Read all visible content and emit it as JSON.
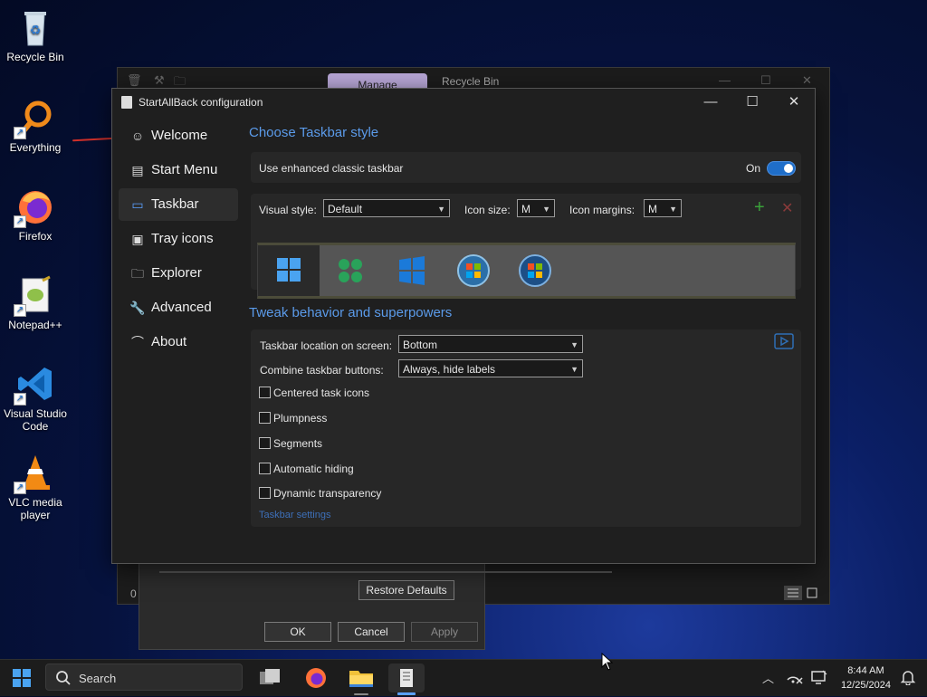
{
  "desktop": {
    "icons": [
      {
        "label": "Recycle Bin",
        "icon": "recycle-bin-icon"
      },
      {
        "label": "Everything",
        "icon": "everything-search-icon"
      },
      {
        "label": "Firefox",
        "icon": "firefox-icon"
      },
      {
        "label": "Notepad++",
        "icon": "notepad-plus-plus-icon"
      },
      {
        "label": "Visual Studio Code",
        "icon": "vscode-icon"
      },
      {
        "label": "VLC media player",
        "icon": "vlc-icon"
      }
    ]
  },
  "background_window": {
    "manage_tab": "Manage",
    "title": "Recycle Bin",
    "status_count": "0"
  },
  "properties_dialog": {
    "restore_defaults": "Restore Defaults",
    "ok": "OK",
    "cancel": "Cancel",
    "apply": "Apply"
  },
  "window": {
    "title": "StartAllBack configuration",
    "controls": {
      "minimize": "—",
      "maximize": "☐",
      "close": "✕"
    }
  },
  "nav": {
    "items": [
      {
        "label": "Welcome",
        "icon": "smiley-icon",
        "active": false
      },
      {
        "label": "Start Menu",
        "icon": "start-menu-icon",
        "active": false
      },
      {
        "label": "Taskbar",
        "icon": "taskbar-icon",
        "active": true
      },
      {
        "label": "Tray icons",
        "icon": "tray-icon",
        "active": false
      },
      {
        "label": "Explorer",
        "icon": "folder-icon",
        "active": false
      },
      {
        "label": "Advanced",
        "icon": "wrench-icon",
        "active": false
      },
      {
        "label": "About",
        "icon": "about-icon",
        "active": false
      }
    ]
  },
  "taskbar_style": {
    "heading": "Choose Taskbar style",
    "enhanced_label": "Use enhanced classic taskbar",
    "enhanced_state": "On",
    "visual_style_label": "Visual style:",
    "visual_style_value": "Default",
    "icon_size_label": "Icon size:",
    "icon_size_value": "M",
    "icon_margins_label": "Icon margins:",
    "icon_margins_value": "M",
    "add_icon": "+",
    "remove_icon": "✕",
    "accent_add": "#3aa13a",
    "accent_remove": "#8a3a3a"
  },
  "tweak": {
    "heading": "Tweak behavior and superpowers",
    "location_label": "Taskbar location on screen:",
    "location_value": "Bottom",
    "combine_label": "Combine taskbar buttons:",
    "combine_value": "Always, hide labels",
    "checkboxes": [
      {
        "label": "Centered task icons",
        "checked": false
      },
      {
        "label": "Plumpness",
        "checked": false
      },
      {
        "label": "Segments",
        "checked": false
      },
      {
        "label": "Automatic hiding",
        "checked": false
      },
      {
        "label": "Dynamic transparency",
        "checked": false
      }
    ],
    "settings_link": "Taskbar settings"
  },
  "taskbar": {
    "search_text": "Search",
    "time": "8:44 AM",
    "date": "12/25/2024"
  },
  "colors": {
    "accent_link": "#5b9bea",
    "toggle_on": "#1f6ec9"
  }
}
